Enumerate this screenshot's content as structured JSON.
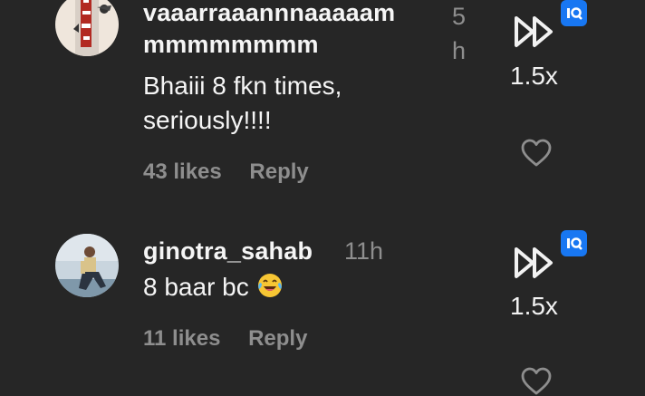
{
  "comments": [
    {
      "username_line1": "vaaarraaannnaaaaam",
      "username_line2": "mmmmmmmm",
      "time_line1": "5",
      "time_line2": "h",
      "text_line1": "Bhaiii 8 fkn times,",
      "text_line2": "seriously!!!!",
      "likes": "43 likes",
      "reply": "Reply",
      "speed": "1.5x",
      "icons": [
        "avatar",
        "fast-forward-icon",
        "iq-badge-icon",
        "heart-icon"
      ]
    },
    {
      "username": "ginotra_sahab",
      "time": "11h",
      "text": "8 baar bc",
      "emoji": "laughing-tears-emoji",
      "likes": "11 likes",
      "reply": "Reply",
      "speed": "1.5x",
      "icons": [
        "avatar",
        "fast-forward-icon",
        "iq-badge-icon",
        "heart-icon"
      ]
    }
  ],
  "colors": {
    "background": "#262626",
    "text": "#f5f5f5",
    "muted": "#8e8e8e",
    "badge": "#1877f2"
  }
}
